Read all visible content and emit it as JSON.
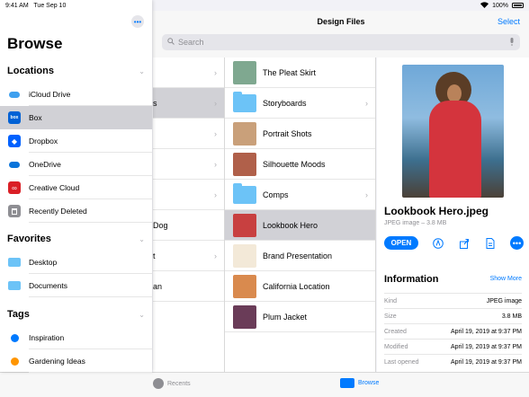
{
  "status": {
    "time": "9:41 AM",
    "date": "Tue Sep 10",
    "battery": "100%"
  },
  "header": {
    "title": "Design Files",
    "select_label": "Select",
    "search_placeholder": "Search"
  },
  "sidebar": {
    "title": "Browse",
    "more_glyph": "•••",
    "locations_label": "Locations",
    "locations": [
      {
        "label": "iCloud Drive",
        "icon": "icloud-icon",
        "color": "#3fa0ef"
      },
      {
        "label": "Box",
        "icon": "box-icon",
        "color": "#0061d5",
        "selected": true
      },
      {
        "label": "Dropbox",
        "icon": "dropbox-icon",
        "color": "#0061fe"
      },
      {
        "label": "OneDrive",
        "icon": "onedrive-icon",
        "color": "#0a74da"
      },
      {
        "label": "Creative Cloud",
        "icon": "creative-cloud-icon",
        "color": "#da1f26"
      },
      {
        "label": "Recently Deleted",
        "icon": "trash-icon",
        "color": "#8e8e93"
      }
    ],
    "favorites_label": "Favorites",
    "favorites": [
      {
        "label": "Desktop",
        "icon": "folder-icon"
      },
      {
        "label": "Documents",
        "icon": "folder-icon"
      }
    ],
    "tags_label": "Tags",
    "tags": [
      {
        "label": "Inspiration",
        "color": "#007aff"
      },
      {
        "label": "Gardening Ideas",
        "color": "#ff9500"
      }
    ]
  },
  "left_column": {
    "rows": [
      {
        "partial_text": ""
      },
      {
        "partial_text": "s",
        "selected": true
      },
      {
        "partial_text": ""
      },
      {
        "partial_text": ""
      },
      {
        "partial_text": ""
      },
      {
        "partial_text": "Dog"
      },
      {
        "partial_text": "t"
      },
      {
        "partial_text": "an"
      }
    ]
  },
  "files": [
    {
      "label": "The Pleat Skirt",
      "kind": "image",
      "color": "#7fa890"
    },
    {
      "label": "Storyboards",
      "kind": "folder"
    },
    {
      "label": "Portrait Shots",
      "kind": "image",
      "color": "#c9a07a"
    },
    {
      "label": "Silhouette Moods",
      "kind": "image",
      "color": "#b0604a"
    },
    {
      "label": "Comps",
      "kind": "folder"
    },
    {
      "label": "Lookbook Hero",
      "kind": "image",
      "color": "#c84040",
      "selected": true
    },
    {
      "label": "Brand Presentation",
      "kind": "image",
      "color": "#f3e9d8"
    },
    {
      "label": "California Location",
      "kind": "image",
      "color": "#d98a4e"
    },
    {
      "label": "Plum Jacket",
      "kind": "image",
      "color": "#6a3c58"
    }
  ],
  "detail": {
    "file_name": "Lookbook Hero.jpeg",
    "file_meta": "JPEG image – 3.8 MB",
    "open_label": "OPEN",
    "info_title": "Information",
    "show_more": "Show More",
    "info": [
      {
        "key": "Kind",
        "value": "JPEG image"
      },
      {
        "key": "Size",
        "value": "3.8 MB"
      },
      {
        "key": "Created",
        "value": "April 19, 2019 at 9:37 PM"
      },
      {
        "key": "Modified",
        "value": "April 19, 2019 at 9:37 PM"
      },
      {
        "key": "Last opened",
        "value": "April 19, 2019 at 9:37 PM"
      }
    ]
  },
  "tabbar": {
    "recents_label": "Recents",
    "browse_label": "Browse"
  }
}
